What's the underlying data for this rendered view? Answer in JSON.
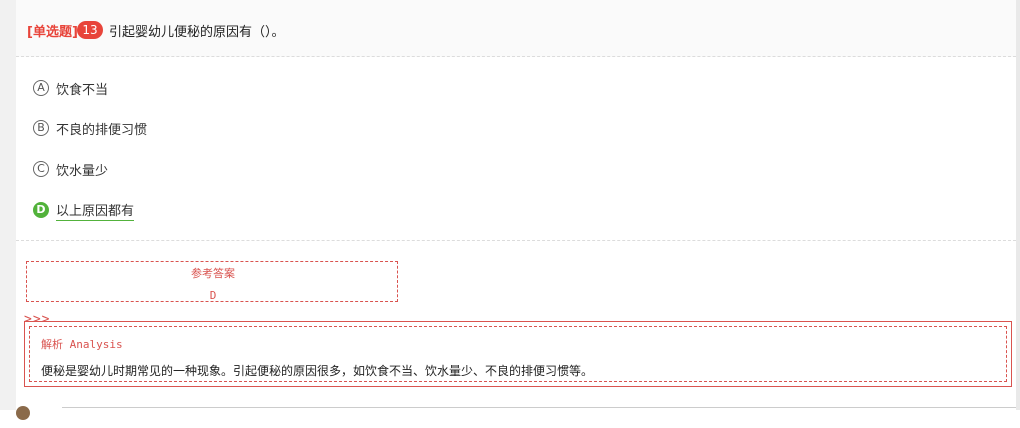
{
  "question": {
    "type_label": "[单选题]",
    "number": "13",
    "stem": "引起婴幼儿便秘的原因有（）。"
  },
  "options": [
    {
      "letter": "A",
      "text": "饮食不当",
      "correct": false
    },
    {
      "letter": "B",
      "text": "不良的排便习惯",
      "correct": false
    },
    {
      "letter": "C",
      "text": "饮水量少",
      "correct": false
    },
    {
      "letter": "D",
      "text": "以上原因都有",
      "correct": true
    }
  ],
  "answer": {
    "label": "参考答案",
    "value": "D"
  },
  "separator": ">>>",
  "analysis": {
    "title": "解析 Analysis",
    "text": "便秘是婴幼儿时期常见的一种现象。引起便秘的原因很多，如饮食不当、饮水量少、不良的排便习惯等。"
  },
  "colors": {
    "accent_red": "#e8443a",
    "correct_green": "#52b23b",
    "analysis_red": "#d9534f"
  }
}
